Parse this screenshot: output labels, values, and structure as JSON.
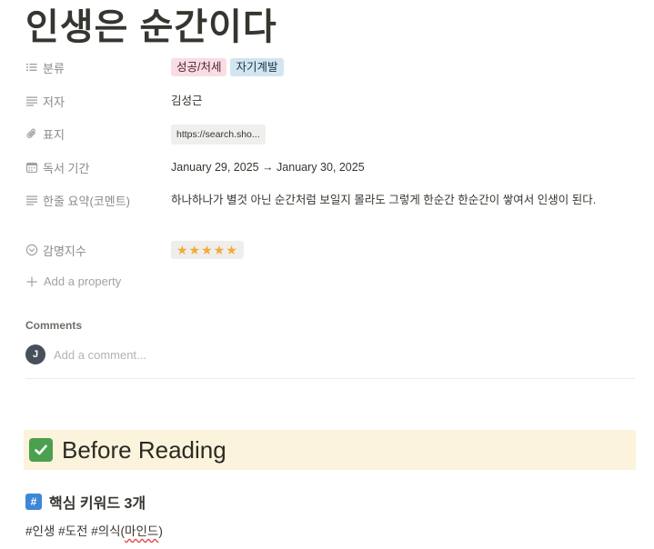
{
  "page": {
    "title": "인생은 순간이다"
  },
  "properties": {
    "category": {
      "label": "분류",
      "icon": "list-icon",
      "tags": [
        {
          "text": "성공/처세",
          "color": "#f9dde3"
        },
        {
          "text": "자기계발",
          "color": "#d3e5ef"
        }
      ]
    },
    "author": {
      "label": "저자",
      "icon": "text-lines-icon",
      "value": "김성근"
    },
    "cover": {
      "label": "표지",
      "icon": "paperclip-icon",
      "value": "https://search.sho..."
    },
    "reading_period": {
      "label": "독서 기간",
      "icon": "calendar-icon",
      "value": "January 29, 2025 → January 30, 2025"
    },
    "summary": {
      "label": "한줄 요약(코멘트)",
      "icon": "text-lines-icon",
      "value": "하나하나가 별것 아닌 순간처럼 보일지 몰라도 그렇게 한순간 한순간이 쌓여서 인생이 된다."
    },
    "rating": {
      "label": "감명지수",
      "icon": "select-circle-icon",
      "value": "★★★★★"
    }
  },
  "add_property": {
    "label": "Add a property"
  },
  "comments": {
    "heading": "Comments",
    "avatar_initial": "J",
    "placeholder": "Add a comment..."
  },
  "callout": {
    "icon": "checkmark-icon",
    "text": "Before Reading"
  },
  "section": {
    "icon": "hash-icon",
    "heading": "핵심 키워드 3개",
    "keywords_prefix": "#인생 #도전 #의식(",
    "keywords_misspelled": "마인드",
    "keywords_suffix": ")"
  },
  "colors": {
    "accent_check": "#4aa04e",
    "callout_bg": "#fbf3db",
    "hash_icon": "#3e86d6",
    "star": "#f2a93b"
  }
}
